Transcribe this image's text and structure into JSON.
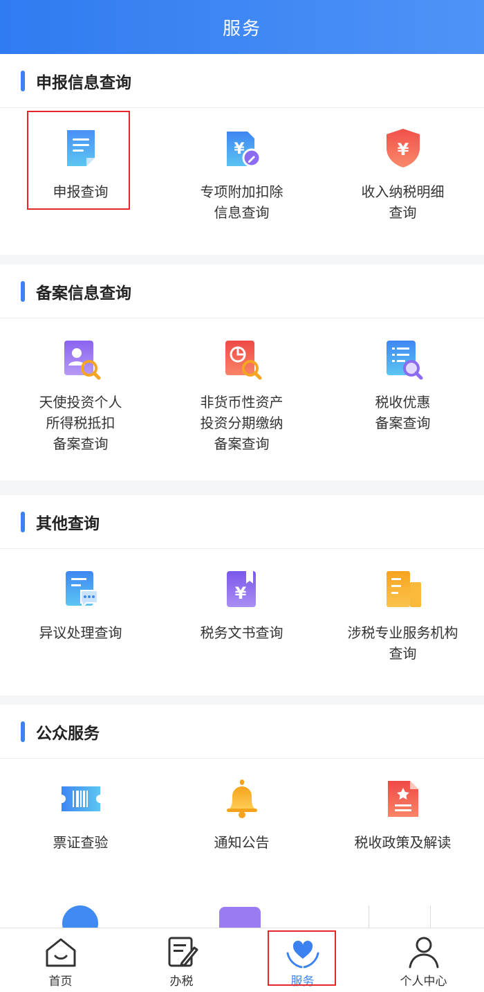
{
  "header": {
    "title": "服务"
  },
  "sections": [
    {
      "title": "申报信息查询",
      "items": [
        {
          "label": "申报查询",
          "icon": "document-icon"
        },
        {
          "label": "专项附加扣除\n信息查询",
          "icon": "yuan-file-edit-icon"
        },
        {
          "label": "收入纳税明细\n查询",
          "icon": "yuan-shield-icon"
        }
      ]
    },
    {
      "title": "备案信息查询",
      "items": [
        {
          "label": "天使投资个人\n所得税抵扣\n备案查询",
          "icon": "person-search-icon"
        },
        {
          "label": "非货币性资产\n投资分期缴纳\n备案查询",
          "icon": "chart-search-icon"
        },
        {
          "label": "税收优惠\n备案查询",
          "icon": "list-search-icon"
        }
      ]
    },
    {
      "title": "其他查询",
      "items": [
        {
          "label": "异议处理查询",
          "icon": "message-document-icon"
        },
        {
          "label": "税务文书查询",
          "icon": "yuan-book-icon"
        },
        {
          "label": "涉税专业服务机构\n查询",
          "icon": "building-icon"
        }
      ]
    },
    {
      "title": "公众服务",
      "items": [
        {
          "label": "票证查验",
          "icon": "barcode-ticket-icon"
        },
        {
          "label": "通知公告",
          "icon": "bell-icon"
        },
        {
          "label": "税收政策及解读",
          "icon": "star-document-icon"
        }
      ]
    }
  ],
  "tabbar": {
    "items": [
      {
        "label": "首页",
        "icon": "home-icon",
        "active": false
      },
      {
        "label": "办税",
        "icon": "edit-document-icon",
        "active": false
      },
      {
        "label": "服务",
        "icon": "heart-hands-icon",
        "active": true
      },
      {
        "label": "个人中心",
        "icon": "user-icon",
        "active": false
      }
    ]
  },
  "colors": {
    "accent": "#3b82f0",
    "highlight": "#e5262b"
  }
}
